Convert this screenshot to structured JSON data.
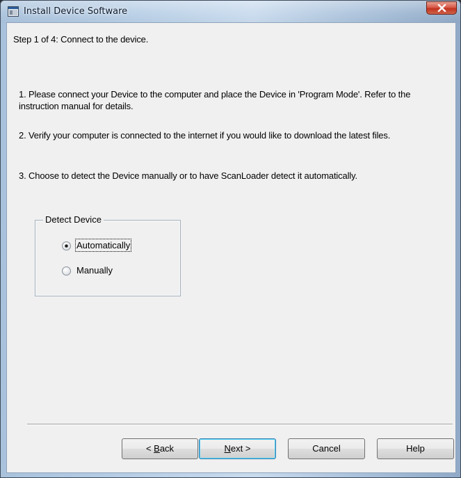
{
  "window": {
    "title": "Install Device Software",
    "close_glyph": "×"
  },
  "step": {
    "title": "Step 1 of 4:  Connect to the device."
  },
  "instructions": [
    "1.  Please connect your Device to the computer and place the Device in 'Program Mode'.  Refer to the instruction manual for details.",
    "2.  Verify your computer is connected to the internet if you would like to download the latest files.",
    "3.  Choose to detect the Device manually or to have ScanLoader detect it automatically."
  ],
  "detect_group": {
    "legend": "Detect Device",
    "options": [
      {
        "label": "Automatically",
        "selected": true
      },
      {
        "label": "Manually",
        "selected": false
      }
    ]
  },
  "buttons": {
    "back": {
      "prefix": "< ",
      "accel": "B",
      "rest": "ack"
    },
    "next": {
      "accel": "N",
      "rest": "ext >"
    },
    "cancel": "Cancel",
    "help": "Help"
  },
  "colors": {
    "dialog_bg": "#f0f0f0",
    "close_button": "#c1331f",
    "default_button_border": "#3c7fb1"
  },
  "icons": {
    "title": "window-app-icon",
    "close": "close-icon"
  }
}
